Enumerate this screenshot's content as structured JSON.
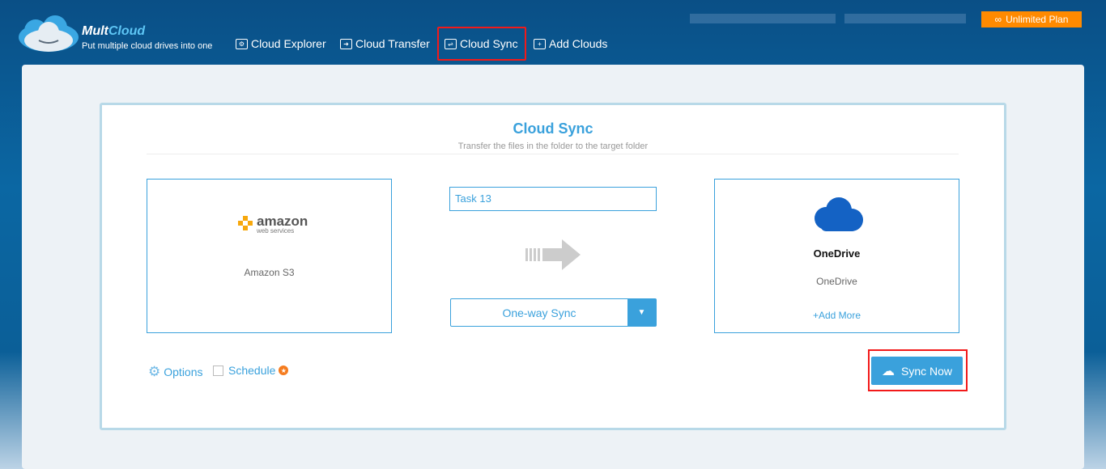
{
  "header": {
    "brand_a": "Mult",
    "brand_b": "Cloud",
    "tagline": "Put multiple cloud drives into one",
    "nav": [
      "Cloud Explorer",
      "Cloud Transfer",
      "Cloud Sync",
      "Add Clouds"
    ],
    "plan": "Unlimited Plan"
  },
  "sync": {
    "title": "Cloud Sync",
    "subtitle": "Transfer the files in the folder to the target folder",
    "source_logo": "amazon",
    "source_logo_sub": "web services",
    "source": "Amazon S3",
    "task_name": "Task 13",
    "mode": "One-way Sync",
    "target_title": "OneDrive",
    "target": "OneDrive",
    "add_more": "+Add More",
    "options": "Options",
    "schedule": "Schedule",
    "sync_now": "Sync Now"
  }
}
